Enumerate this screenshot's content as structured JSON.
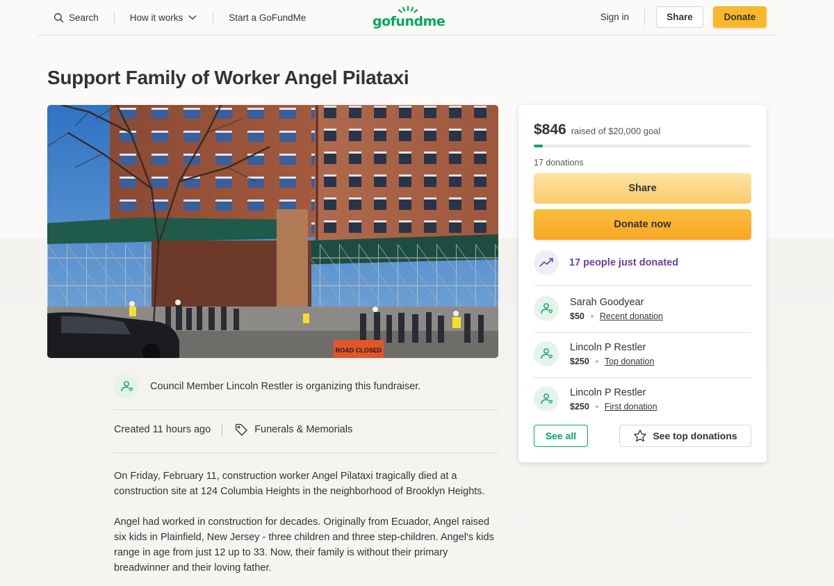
{
  "header": {
    "search_label": "Search",
    "how_it_works_label": "How it works",
    "start_label": "Start a GoFundMe",
    "logo_text": "gofundme",
    "signin_label": "Sign in",
    "share_label": "Share",
    "donate_label": "Donate"
  },
  "page": {
    "title": "Support Family of Worker Angel Pilataxi",
    "hero_sign_text": "ROAD CLOSED"
  },
  "organizer": {
    "text": "Council Member Lincoln Restler is organizing this fundraiser."
  },
  "meta": {
    "created": "Created 11 hours ago",
    "category": "Funerals & Memorials"
  },
  "story": {
    "paragraphs": [
      "On Friday, February 11, construction worker Angel Pilataxi tragically died at a construction site at 124 Columbia Heights in the neighborhood of Brooklyn Heights.",
      "Angel had worked in construction for decades. Originally from Ecuador, Angel raised six kids in Plainfield, New Jersey - three children and three step-children. Angel's kids range in age from just 12 up to 33. Now, their family is without their primary breadwinner and their loving father."
    ]
  },
  "donation_card": {
    "raised_amount": "$846",
    "goal_text": "raised of $20,000 goal",
    "progress_fraction": 0.0423,
    "donation_count": "17 donations",
    "share_label": "Share",
    "donate_label": "Donate now",
    "trend_text": "17 people just donated",
    "donors": [
      {
        "name": "Sarah Goodyear",
        "amount": "$50",
        "tag": "Recent donation"
      },
      {
        "name": "Lincoln P Restler",
        "amount": "$250",
        "tag": "Top donation"
      },
      {
        "name": "Lincoln P Restler",
        "amount": "$250",
        "tag": "First donation"
      }
    ],
    "see_all_label": "See all",
    "see_top_label": "See top donations"
  },
  "colors": {
    "brand_green": "#02a95c",
    "donate_yellow": "#f9b72b",
    "trend_purple": "#6b3fa0"
  },
  "icons": [
    "search-icon",
    "chevron-down-icon",
    "tag-icon",
    "trending-up-icon",
    "donor-heart-icon",
    "star-icon"
  ]
}
